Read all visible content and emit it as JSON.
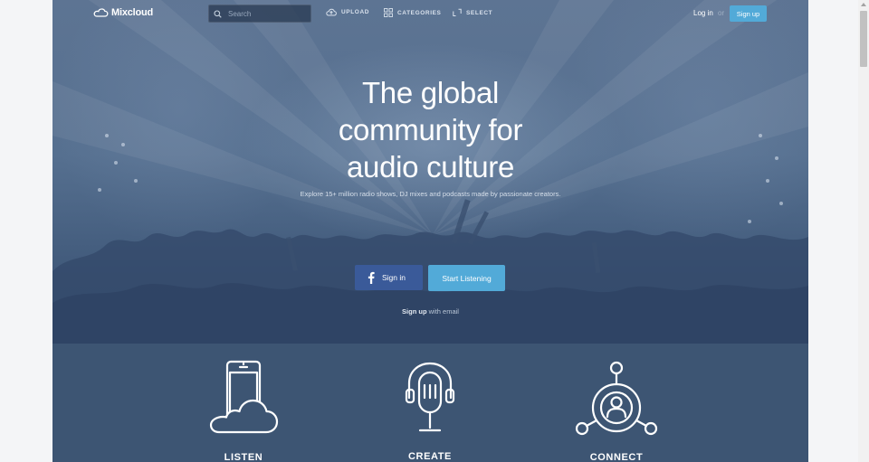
{
  "nav": {
    "logo_text": "Mixcloud",
    "search_placeholder": "Search",
    "upload_label": "UPLOAD",
    "categories_label": "CATEGORIES",
    "select_label": "SELECT",
    "login_label": "Log in",
    "or_label": "or",
    "signup_label": "Sign up"
  },
  "hero": {
    "headline_line1": "The global",
    "headline_line2": "community for",
    "headline_line3": "audio culture",
    "subtitle": "Explore 15+ million radio shows, DJ mixes and podcasts made by passionate creators.",
    "facebook_button_label": "Sign in",
    "start_button_label": "Start Listening",
    "email_signup_bold": "Sign up",
    "email_signup_rest": " with email"
  },
  "features": [
    {
      "label": "LISTEN",
      "icon": "phone-cloud-icon"
    },
    {
      "label": "CREATE",
      "icon": "microphone-headphones-icon"
    },
    {
      "label": "CONNECT",
      "icon": "network-person-icon"
    }
  ],
  "colors": {
    "page_bg": "#3d5573",
    "accent_blue": "#52aad8",
    "facebook_blue": "#3a5a99",
    "outer_bg": "#f4f5f7"
  }
}
